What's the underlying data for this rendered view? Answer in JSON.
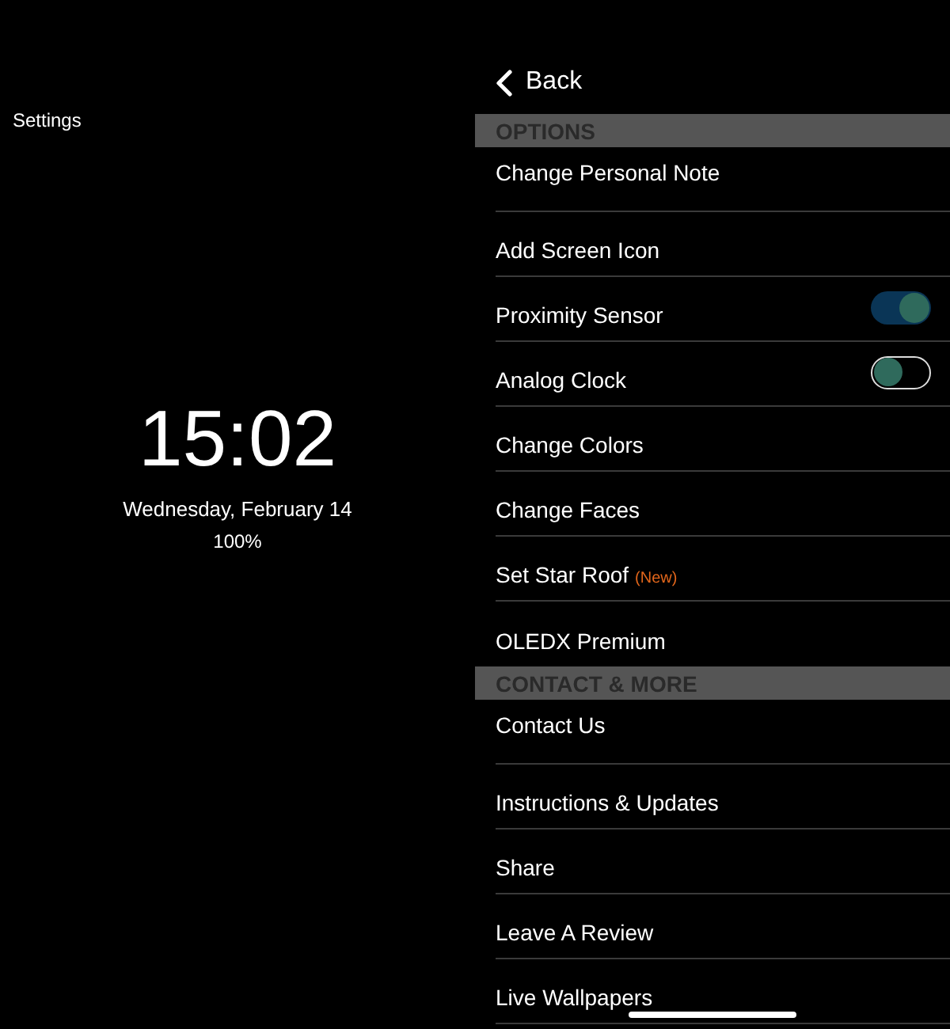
{
  "left_panel": {
    "title": "Settings",
    "time": "15:02",
    "date": "Wednesday, February 14",
    "battery": "100%"
  },
  "nav": {
    "back": "Back"
  },
  "sections": [
    {
      "header": "OPTIONS",
      "items": [
        {
          "kind": "link",
          "label": "Change Personal Note"
        },
        {
          "kind": "link",
          "label": "Add Screen Icon"
        },
        {
          "kind": "toggle",
          "label": "Proximity Sensor",
          "on": true
        },
        {
          "kind": "toggle",
          "label": "Analog Clock",
          "on": false
        },
        {
          "kind": "link",
          "label": "Change Colors"
        },
        {
          "kind": "link",
          "label": "Change Faces"
        },
        {
          "kind": "link",
          "label": "Set Star Roof",
          "badge": "(New)"
        },
        {
          "kind": "link",
          "label": "OLEDX Premium"
        }
      ]
    },
    {
      "header": "CONTACT & MORE",
      "items": [
        {
          "kind": "link",
          "label": "Contact Us"
        },
        {
          "kind": "link",
          "label": "Instructions & Updates"
        },
        {
          "kind": "link",
          "label": "Share"
        },
        {
          "kind": "link",
          "label": "Leave A Review"
        },
        {
          "kind": "link",
          "label": "Live Wallpapers"
        }
      ]
    }
  ]
}
